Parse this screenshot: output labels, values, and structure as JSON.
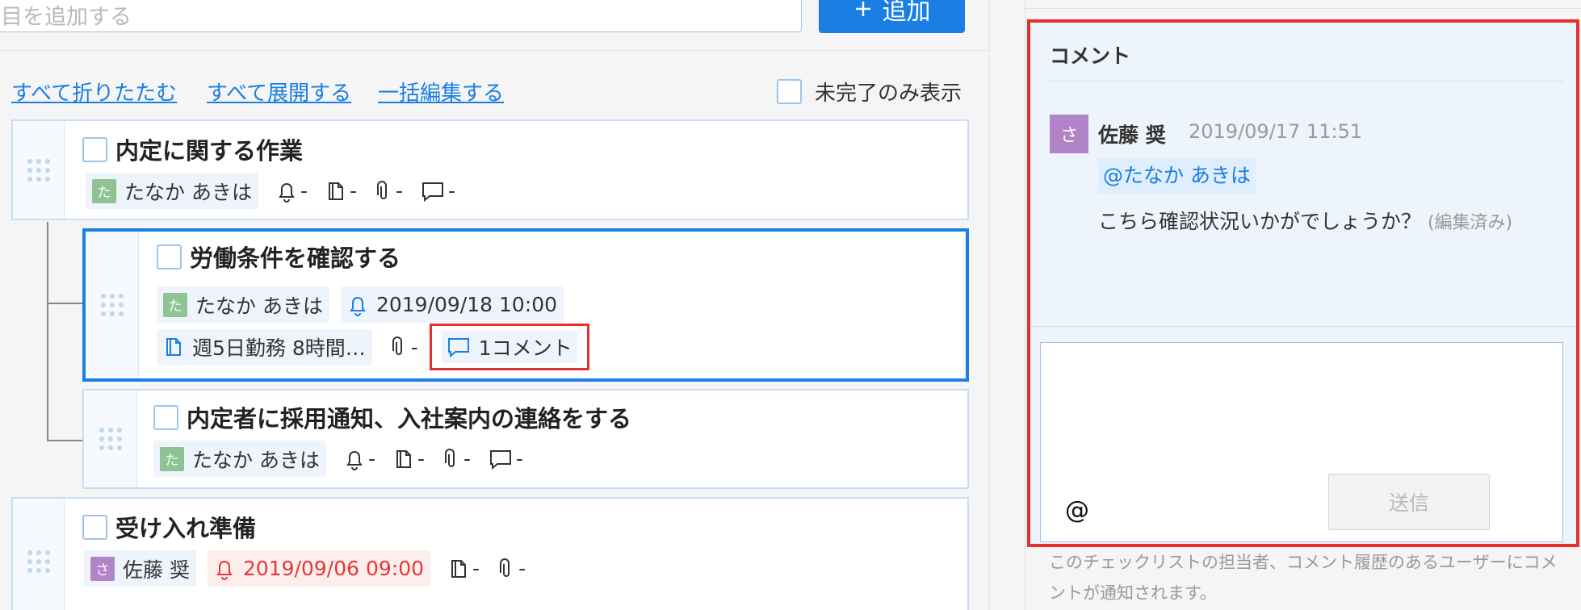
{
  "add_item": {
    "placeholder": "目を追加する",
    "button_label": "追加",
    "button_icon": "plus-icon"
  },
  "toolbar": {
    "collapse_all": "すべて折りたたむ",
    "expand_all": "すべて展開する",
    "bulk_edit": "一括編集する",
    "only_incomplete": "未完了のみ表示"
  },
  "tasks": [
    {
      "title": "内定に関する作業",
      "assignee_initial": "た",
      "assignee": "たなか あきは",
      "reminder": "-",
      "memo": "-",
      "attachment": "-",
      "comment": "-"
    },
    {
      "title": "労働条件を確認する",
      "assignee_initial": "た",
      "assignee": "たなか あきは",
      "reminder": "2019/09/18 10:00",
      "memo": "週5日勤務 8時間…",
      "attachment": "-",
      "comment": "1コメント"
    },
    {
      "title": "内定者に採用通知、入社案内の連絡をする",
      "assignee_initial": "た",
      "assignee": "たなか あきは",
      "reminder": "-",
      "memo": "-",
      "attachment": "-",
      "comment": "-"
    },
    {
      "title": "受け入れ準備",
      "assignee_initial": "さ",
      "assignee": "佐藤 奨",
      "reminder": "2019/09/06 09:00",
      "memo": "-",
      "attachment": "-"
    }
  ],
  "comments": {
    "heading": "コメント",
    "items": [
      {
        "avatar_initial": "さ",
        "author": "佐藤 奨",
        "time": "2019/09/17 11:51",
        "mention": "@たなか あきは",
        "body": "こちら確認状況いかがでしょうか？",
        "edited": "(編集済み)"
      }
    ],
    "input_at": "@",
    "send_label": "送信",
    "note": "このチェックリストの担当者、コメント履歴のあるユーザーにコメントが通知されます。"
  },
  "colors": {
    "accent": "#1a7ee3",
    "highlight": "#e62f2f",
    "overdue": "#e53935"
  }
}
